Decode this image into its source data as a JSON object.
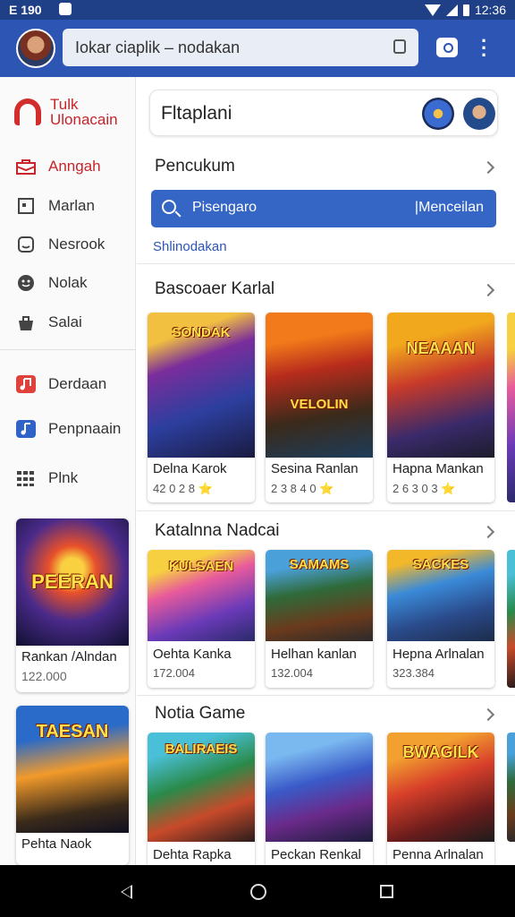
{
  "status": {
    "time": "E 190",
    "clock": "12:36"
  },
  "appbar": {
    "search_text": "Iokar ciaplik – nodakan"
  },
  "sidebar": {
    "brand": "Tulk Ulonacain",
    "items": [
      {
        "label": "Anngah",
        "icon": "toolbox-icon"
      },
      {
        "label": "Marlan",
        "icon": "calendar-icon"
      },
      {
        "label": "Nesrook",
        "icon": "smile-icon"
      },
      {
        "label": "Nolak",
        "icon": "face-icon"
      },
      {
        "label": "Salai",
        "icon": "bag-icon"
      },
      {
        "label": "Derdaan",
        "icon": "music-red-icon"
      },
      {
        "label": "Penpnaain",
        "icon": "music-blue-icon"
      },
      {
        "label": "Plnk",
        "icon": "grid-icon"
      }
    ],
    "cards": [
      {
        "title": "Rankan /Alndan",
        "meta": "122.000",
        "art_text": "PEERAN"
      },
      {
        "title": "Pehta Naok",
        "meta": "",
        "art_text": "TAESAN"
      }
    ]
  },
  "main": {
    "hero_title": "Fltaplani",
    "section1": "Pencukum",
    "search_left": "Pisengaro",
    "search_right": "|Menceilan",
    "link": "Shlinodakan",
    "section2": "Bascoaer Karlal",
    "row1": [
      {
        "title": "Delna Karok",
        "meta": "42 0 2 8 ⭐",
        "art_text": "SONDAK"
      },
      {
        "title": "Sesina Ranlan",
        "meta": "2 3 8 4 0 ⭐",
        "art_text": "VELOLIN"
      },
      {
        "title": "Hapna Mankan",
        "meta": "2 6 3 0 3 ⭐",
        "art_text": "NEAAAN"
      }
    ],
    "section3": "Katalnna Nadcai",
    "row2": [
      {
        "title": "Oehta Kanka",
        "meta": "172.004",
        "art_text": "KULSAEN"
      },
      {
        "title": "Helhan kanlan",
        "meta": "132.004",
        "art_text": "SAMAMS"
      },
      {
        "title": "Hepna Arlnalan",
        "meta": "323.384",
        "art_text": "SACKES"
      }
    ],
    "section4": "Notia Game",
    "row3": [
      {
        "title": "Dehta Rapka",
        "art_text": "BALIRAEIS"
      },
      {
        "title": "Peckan Renkal",
        "art_text": ""
      },
      {
        "title": "Penna Arlnalan",
        "art_text": "BWAGILK"
      }
    ]
  },
  "colors": {
    "appbar": "#2d55b4",
    "accent_red": "#c8242a",
    "button_blue": "#3566c6"
  }
}
